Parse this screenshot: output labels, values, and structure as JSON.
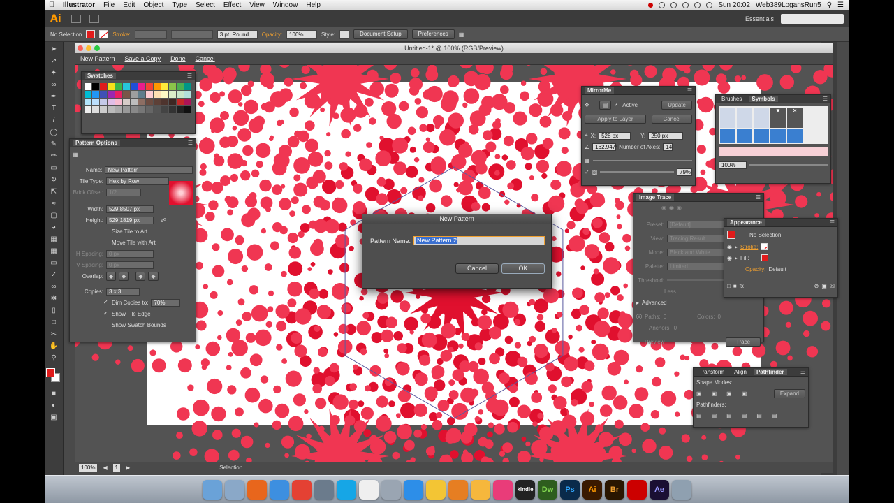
{
  "menubar": {
    "app": "Illustrator",
    "items": [
      "File",
      "Edit",
      "Object",
      "Type",
      "Select",
      "Effect",
      "View",
      "Window",
      "Help"
    ],
    "clock": "Sun 20:02",
    "user": "Web389LogansRun5"
  },
  "appbar": {
    "logo": "Ai",
    "workspace": "Essentials"
  },
  "control": {
    "selection": "No Selection",
    "stroke_label": "Stroke:",
    "brush": "3 pt. Round",
    "opacity_label": "Opacity:",
    "opacity": "100%",
    "style_label": "Style:",
    "doc_setup": "Document Setup",
    "preferences": "Preferences"
  },
  "document": {
    "title": "Untitled-1* @ 100% (RGB/Preview)",
    "pattern_mode": "New Pattern",
    "save_copy": "Save a Copy",
    "done": "Done",
    "cancel": "Cancel",
    "zoom": "100%",
    "artboard": "1",
    "status": "Selection"
  },
  "swatches": {
    "title": "Swatches"
  },
  "pattern_options": {
    "title": "Pattern Options",
    "name_label": "Name:",
    "name": "New Pattern",
    "tile_type_label": "Tile Type:",
    "tile_type": "Hex by Row",
    "brick_offset_label": "Brick Offset:",
    "brick_offset": "1/2",
    "width_label": "Width:",
    "width": "529.8507 px",
    "height_label": "Height:",
    "height": "529.1819 px",
    "size_tile": "Size Tile to Art",
    "move_tile": "Move Tile with Art",
    "h_spacing_label": "H Spacing:",
    "h_spacing": "0 px",
    "v_spacing_label": "V Spacing:",
    "v_spacing": "0 px",
    "overlap_label": "Overlap:",
    "copies_label": "Copies:",
    "copies": "3 x 3",
    "dim_copies": "Dim Copies to:",
    "dim_value": "70%",
    "show_tile_edge": "Show Tile Edge",
    "show_swatch_bounds": "Show Swatch Bounds"
  },
  "mirrorme": {
    "title": "MirrorMe",
    "active": "Active",
    "update": "Update",
    "apply": "Apply to Layer",
    "cancel": "Cancel",
    "x_label": "X:",
    "x": "528 px",
    "y_label": "Y:",
    "y": "250 px",
    "angle": "162.947°",
    "axes_label": "Number of Axes:",
    "axes": "14",
    "percent": "79%"
  },
  "brushes": {
    "tab1": "Brushes",
    "tab2": "Symbols",
    "zoom": "100%"
  },
  "image_trace": {
    "title": "Image Trace",
    "preset_label": "Preset:",
    "preset": "[Default]",
    "view_label": "View:",
    "view": "Tracing Result",
    "mode_label": "Mode:",
    "mode": "Black and White",
    "palette_label": "Palette:",
    "palette": "Limited",
    "threshold_label": "Threshold:",
    "less": "Less",
    "advanced": "Advanced",
    "paths_label": "Paths:",
    "paths": "0",
    "colors_label": "Colors:",
    "colors": "0",
    "anchors_label": "Anchors:",
    "anchors": "0",
    "preview": "Preview",
    "trace": "Trace"
  },
  "appearance": {
    "title": "Appearance",
    "selection": "No Selection",
    "stroke": "Stroke:",
    "fill": "Fill:",
    "opacity": "Opacity:",
    "opacity_value": "Default"
  },
  "pathfinder": {
    "tab1": "Transform",
    "tab2": "Align",
    "tab3": "Pathfinder",
    "shape_modes": "Shape Modes:",
    "expand": "Expand",
    "pathfinders": "Pathfinders:"
  },
  "dialog": {
    "title": "New Pattern",
    "label": "Pattern Name:",
    "value": "New Pattern 2",
    "cancel": "Cancel",
    "ok": "OK"
  },
  "colors": {
    "pattern_red": "#f03652",
    "dark_red": "#e0102e",
    "accent_orange": "#f0a030"
  },
  "dock_apps": [
    "Finder",
    "Preview",
    "Firefox",
    "Safari",
    "Chrome",
    "Photo Booth",
    "Skype",
    "TextEdit",
    "Rocket",
    "App Store",
    "Photos",
    "GarageBand",
    "Sketch",
    "iTunes",
    "Kindle",
    "Dw",
    "Ps",
    "Ai",
    "Br",
    "Acrobat",
    "Ae",
    "Trash"
  ],
  "dock_labels": {
    "dw": "Dw",
    "ps": "Ps",
    "ai": "Ai",
    "br": "Br",
    "ae": "Ae",
    "kindle": "kindle"
  }
}
